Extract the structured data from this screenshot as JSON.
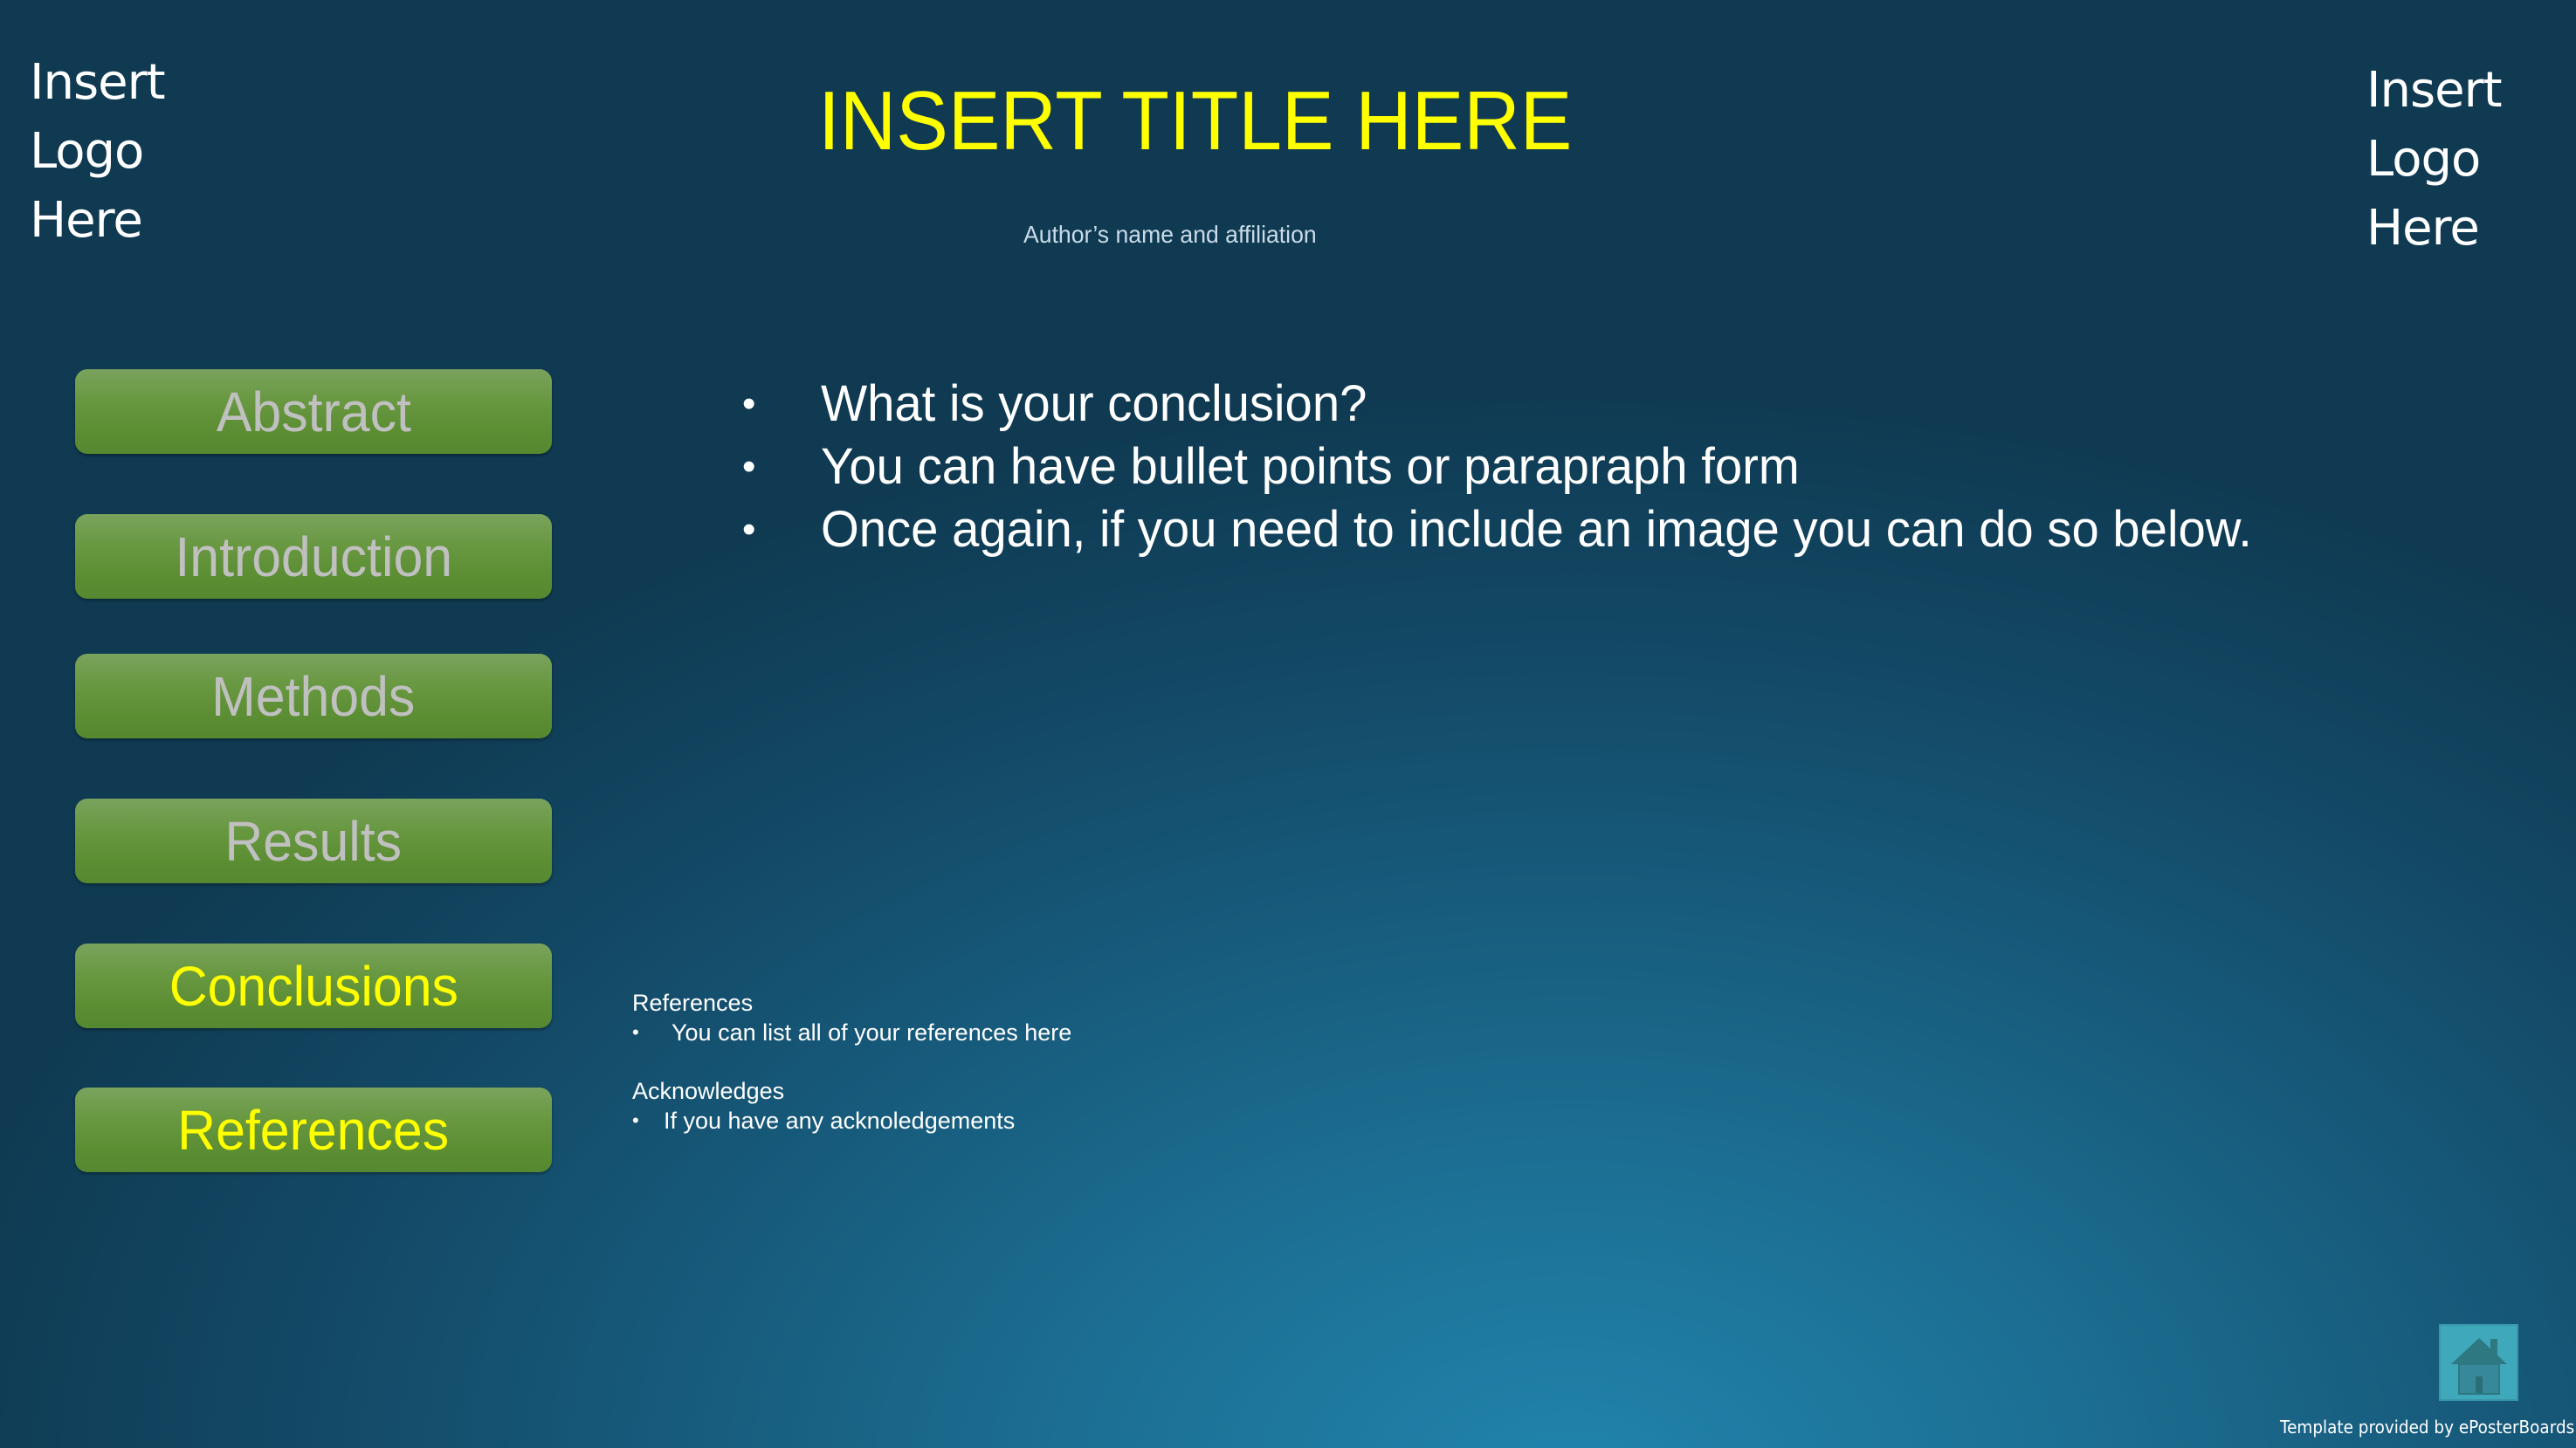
{
  "logos": {
    "left": [
      "Insert",
      "Logo",
      "Here"
    ],
    "right": [
      "Insert",
      "Logo",
      "Here"
    ]
  },
  "header": {
    "title": "INSERT TITLE HERE",
    "author": "Author’s name and affiliation"
  },
  "nav": {
    "items": [
      {
        "label": "Abstract",
        "active": false
      },
      {
        "label": "Introduction",
        "active": false
      },
      {
        "label": "Methods",
        "active": false
      },
      {
        "label": "Results",
        "active": false
      },
      {
        "label": "Conclusions",
        "active": true
      },
      {
        "label": "References",
        "active": true
      }
    ]
  },
  "content": {
    "bullet_glyph": "•",
    "bullets": [
      "What is your conclusion?",
      "You can have bullet points or parapraph form",
      "Once again, if you need to include an image you can do so below."
    ]
  },
  "references": {
    "heading": "References",
    "items": [
      "You can list all of your references here"
    ],
    "ack_heading": "Acknowledges",
    "ack_items": [
      "If you have any acknoledgements"
    ]
  },
  "footer": {
    "home_icon": "home-icon",
    "credit": "Template provided by ePosterBoards"
  },
  "colors": {
    "title": "#ffff00",
    "nav_active_text": "#ffff00",
    "nav_inactive_text": "#c0c0c0",
    "nav_button_fill": "#67973f",
    "home_button_fill": "#3fa8ba",
    "background_dark": "#0f3a52",
    "background_light": "#2184ad"
  }
}
